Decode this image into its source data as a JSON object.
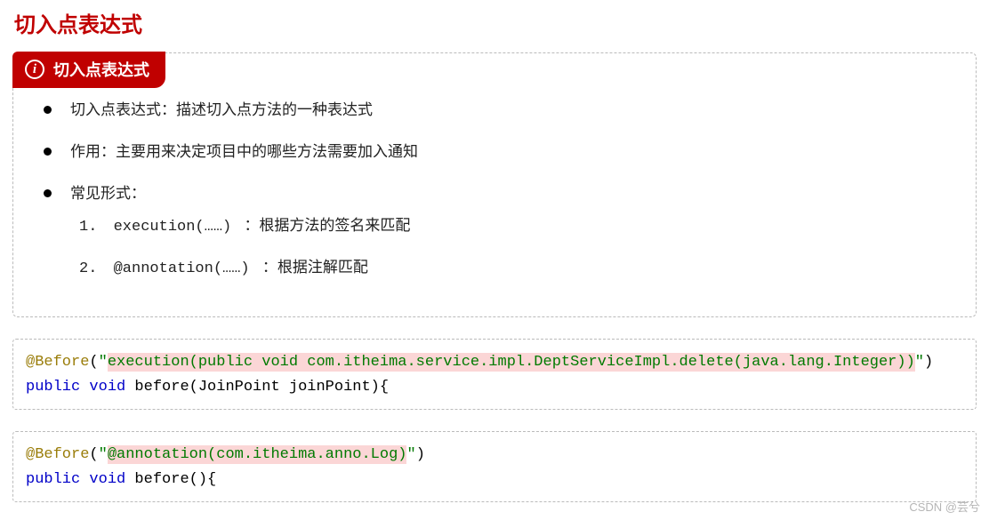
{
  "title": "切入点表达式",
  "infoBadge": {
    "iconLabel": "i",
    "text": "切入点表达式"
  },
  "bullets": [
    {
      "text": "切入点表达式：描述切入点方法的一种表达式"
    },
    {
      "text": "作用：主要用来决定项目中的哪些方法需要加入通知"
    },
    {
      "text": "常见形式：",
      "sub": [
        {
          "num": "1.",
          "code": "execution(……)",
          "desc": "：根据方法的签名来匹配"
        },
        {
          "num": "2.",
          "code": "@annotation(……) ",
          "desc": "：根据注解匹配"
        }
      ]
    }
  ],
  "code1": {
    "anno": "@Before",
    "paren1": "(",
    "q1": "\"",
    "hl": "execution(public void com.itheima.service.impl.DeptServiceImpl.delete(java.lang.Integer))",
    "q2": "\"",
    "paren2": ")",
    "line2_kw1": "public",
    "line2_kw2": "void",
    "line2_rest": " before(JoinPoint joinPoint){"
  },
  "code2": {
    "anno": "@Before",
    "paren1": "(",
    "q1": "\"",
    "hl": "@annotation(com.itheima.anno.Log)",
    "q2": "\"",
    "paren2": ")",
    "line2_kw1": "public",
    "line2_kw2": "void",
    "line2_rest": " before(){"
  },
  "watermark": "CSDN @芸兮"
}
